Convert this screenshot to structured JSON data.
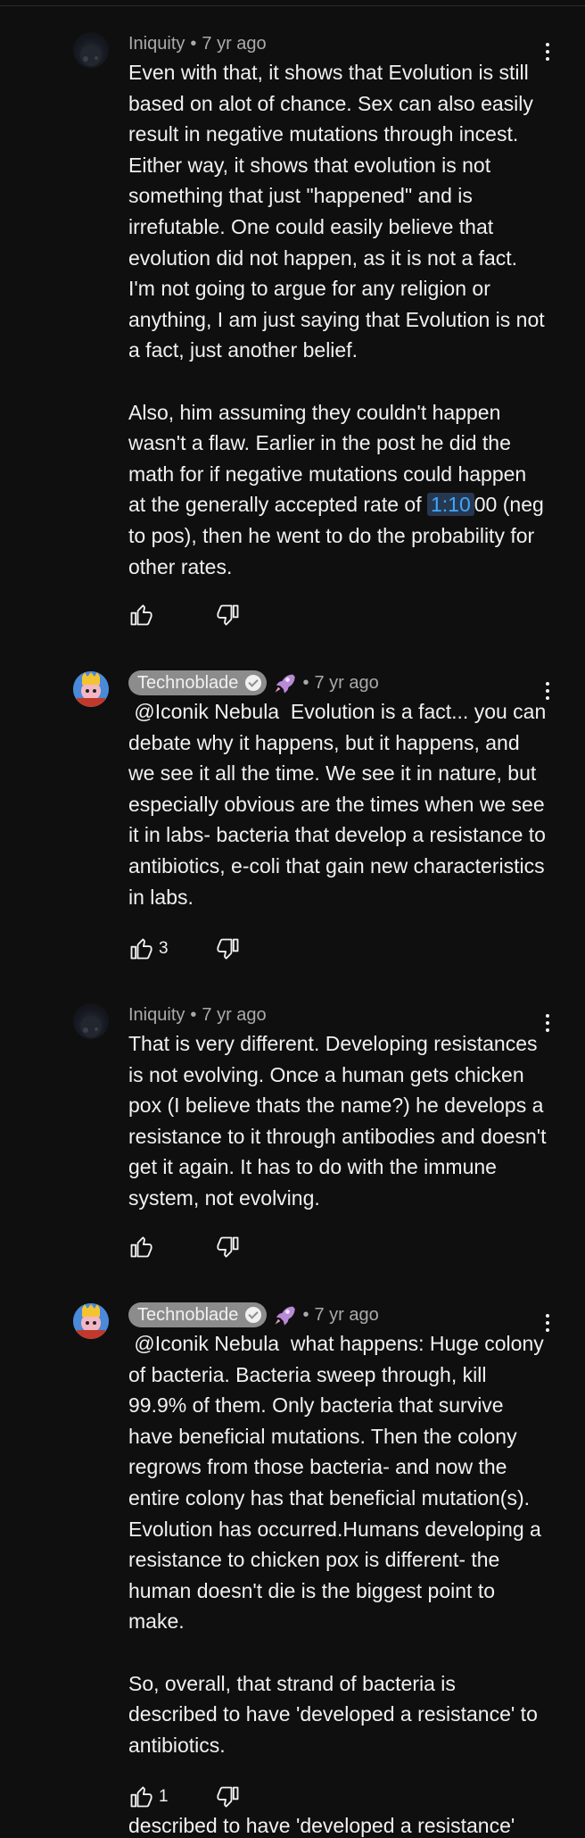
{
  "comments": [
    {
      "author": "Iniquity",
      "time": "7 yr ago",
      "text_before": "Even with that, it shows that Evolution is still based on alot of chance. Sex can also easily result in negative mutations through incest. Either way, it shows that evolution is not something that just \"happened\" and is irrefutable. One could easily believe that evolution did not happen, as it is not a fact. I'm not going to argue for any religion or anything, I am just saying that Evolution is not a fact, just another belief.\n\nAlso, him assuming they couldn't happen wasn't a flaw. Earlier in the post he did the math for if negative mutations could happen at the generally accepted rate of ",
      "timestamp_link": "1:10",
      "text_after": "00 (neg to pos), then he went to do the probability for other rates.",
      "likes": ""
    },
    {
      "author": "Technoblade",
      "time": "7 yr ago",
      "text": " @Iconik Nebula  Evolution is a fact... you can debate why it happens, but it happens, and we see it all the time. We see it in nature, but especially obvious are the times when we see it in labs- bacteria that develop a resistance to antibiotics, e-coli that gain new characteristics in labs.",
      "likes": "3"
    },
    {
      "author": "Iniquity",
      "time": "7 yr ago",
      "text": "That is very different. Developing resistances is not evolving. Once a human gets chicken pox (I believe thats the name?) he develops a resistance to it through antibodies and doesn't get it again. It has to do with the immune system, not evolving.",
      "likes": ""
    },
    {
      "author": "Technoblade",
      "time": "7 yr ago",
      "text": " @Iconik Nebula  what happens: Huge colony of bacteria. Bacteria sweep through, kill 99.9% of them. Only bacteria that survive have beneficial mutations. Then the colony regrows from those bacteria- and now the entire colony has that beneficial mutation(s). Evolution has occurred.Humans developing a resistance to chicken pox is different- the human doesn't die is the biggest point to make.\n\nSo, overall, that strand of bacteria is described to have 'developed a resistance' to antibiotics.",
      "likes": "1"
    }
  ],
  "separator": "•",
  "cutoff_text": "described to have 'developed a resistance'",
  "icons": [
    "avatar",
    "verified-check-icon",
    "rocket-icon",
    "more-vert-icon",
    "thumb-up-icon",
    "thumb-down-icon"
  ]
}
